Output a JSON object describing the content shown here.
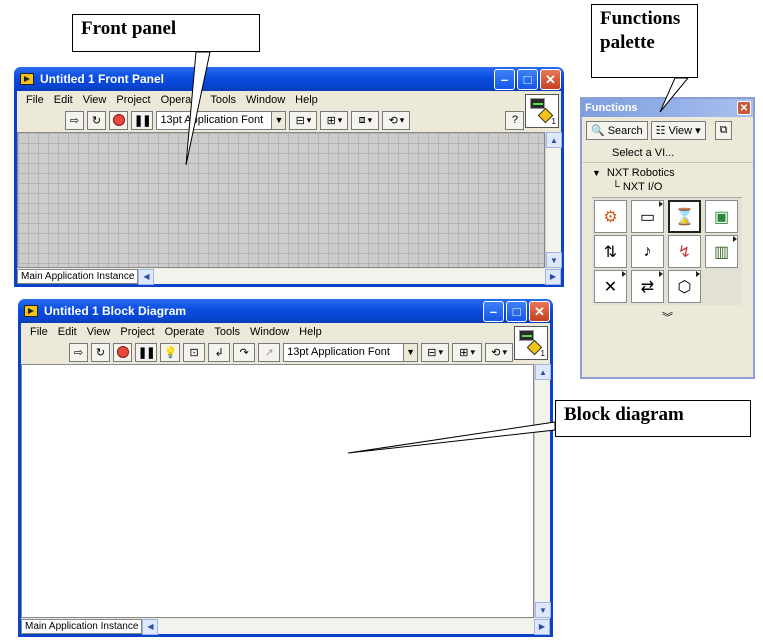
{
  "callouts": {
    "front_panel": "Front panel",
    "functions_palette_line1": "Functions",
    "functions_palette_line2": "palette",
    "block_diagram": "Block diagram"
  },
  "front_panel_window": {
    "title": "Untitled 1 Front Panel",
    "menu": [
      "File",
      "Edit",
      "View",
      "Project",
      "Operate",
      "Tools",
      "Window",
      "Help"
    ],
    "font": "13pt Application Font",
    "instance": "Main Application Instance",
    "vi_icon_number": "1",
    "help_glyph": "?"
  },
  "block_diagram_window": {
    "title": "Untitled 1 Block Diagram",
    "menu": [
      "File",
      "Edit",
      "View",
      "Project",
      "Operate",
      "Tools",
      "Window",
      "Help"
    ],
    "font": "13pt Application Font",
    "instance": "Main Application Instance",
    "vi_icon_number": "1"
  },
  "palette": {
    "title": "Functions",
    "search_label": "Search",
    "view_label": "View",
    "select_vi": "Select a VI...",
    "category": "NXT Robotics",
    "subcategory": "NXT I/O",
    "icons": [
      "motor-icon",
      "brick-icon",
      "wait-icon",
      "display-icon",
      "io-icon",
      "sound-icon",
      "sensor-icon",
      "files-icon",
      "tools-icon",
      "bluetooth-icon",
      "advanced-icon"
    ]
  },
  "colors": {
    "titlebar": "#0a4ce0",
    "window_bg": "#ece9d8",
    "grid": "#cccccc",
    "close_btn": "#c4401e"
  }
}
